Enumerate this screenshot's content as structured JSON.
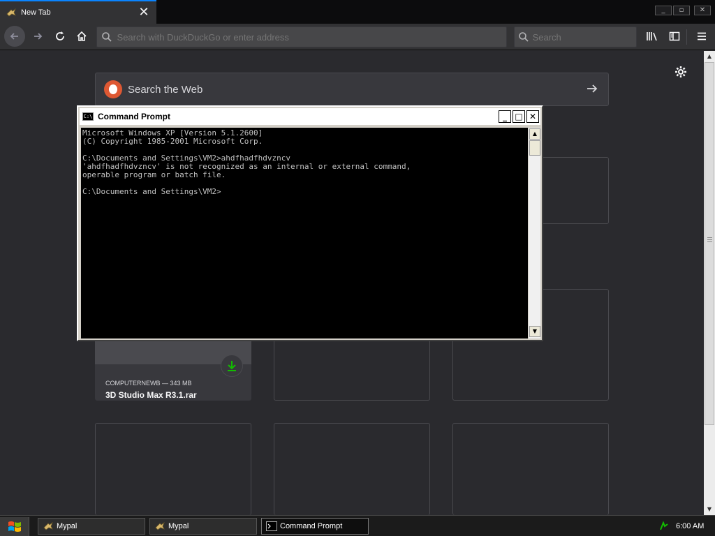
{
  "browser": {
    "tab": {
      "title": "New Tab",
      "close_symbol": "✕"
    },
    "window_controls": [
      "_",
      "▫",
      "✕"
    ],
    "url_placeholder": "Search with DuckDuckGo or enter address",
    "search_placeholder": "Search",
    "icons": {
      "back": "arrow-left-icon",
      "forward": "arrow-right-icon",
      "reload": "reload-icon",
      "home": "home-icon",
      "library": "library-icon",
      "sidebar": "sidebar-icon",
      "menu": "hamburger-menu-icon"
    }
  },
  "newtab": {
    "websearch_placeholder": "Search the Web",
    "download_tile": {
      "source": "COMPUTERNEWB — 343 MB",
      "filename": "3D Studio Max R3.1.rar"
    }
  },
  "cmd": {
    "title": "Command Prompt",
    "icon_text": "C:\\",
    "lines": [
      "Microsoft Windows XP [Version 5.1.2600]",
      "(C) Copyright 1985-2001 Microsoft Corp.",
      "",
      "C:\\Documents and Settings\\VM2>ahdfhadfhdvzncv",
      "'ahdfhadfhdvzncv' is not recognized as an internal or external command,",
      "operable program or batch file.",
      "",
      "C:\\Documents and Settings\\VM2>"
    ]
  },
  "taskbar": {
    "items": [
      {
        "label": "Mypal"
      },
      {
        "label": "Mypal"
      },
      {
        "label": "Command Prompt"
      }
    ],
    "clock": "6:00 AM"
  },
  "colors": {
    "content_bg": "#2a2a2e",
    "toolbar_bg": "#323234",
    "download_green": "#12bc00",
    "duckduckgo_orange": "#de5833"
  }
}
